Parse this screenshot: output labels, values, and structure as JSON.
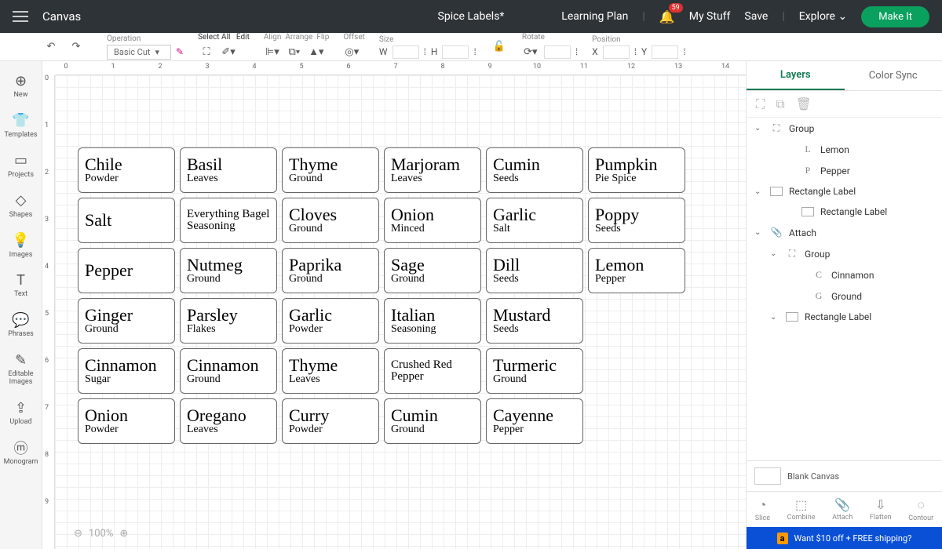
{
  "top": {
    "canvas": "Canvas",
    "title": "Spice Labels*",
    "learning": "Learning Plan",
    "badge": "59",
    "mystuff": "My Stuff",
    "save": "Save",
    "explore": "Explore",
    "makeit": "Make It"
  },
  "tool": {
    "operation": "Operation",
    "basiccut": "Basic Cut",
    "selectall": "Select All",
    "edit": "Edit",
    "align": "Align",
    "arrange": "Arrange",
    "flip": "Flip",
    "offset": "Offset",
    "size": "Size",
    "w": "W",
    "h": "H",
    "rotate": "Rotate",
    "position": "Position",
    "x": "X",
    "y": "Y"
  },
  "nav": [
    {
      "icon": "⊕",
      "label": "New"
    },
    {
      "icon": "👕",
      "label": "Templates"
    },
    {
      "icon": "▭",
      "label": "Projects"
    },
    {
      "icon": "◇",
      "label": "Shapes"
    },
    {
      "icon": "💡",
      "label": "Images"
    },
    {
      "icon": "T",
      "label": "Text"
    },
    {
      "icon": "💬",
      "label": "Phrases"
    },
    {
      "icon": "✎",
      "label": "Editable Images"
    },
    {
      "icon": "⇪",
      "label": "Upload"
    },
    {
      "icon": "ⓜ",
      "label": "Monogram"
    }
  ],
  "ruler_h": [
    "0",
    "1",
    "2",
    "3",
    "4",
    "5",
    "6",
    "7",
    "8",
    "9",
    "10",
    "11",
    "12",
    "13",
    "14"
  ],
  "ruler_v": [
    "0",
    "1",
    "2",
    "3",
    "4",
    "5",
    "6",
    "7",
    "8",
    "9"
  ],
  "spices": [
    {
      "t1": "Chile",
      "t2": "Powder"
    },
    {
      "t1": "Basil",
      "t2": "Leaves"
    },
    {
      "t1": "Thyme",
      "t2": "Ground"
    },
    {
      "t1": "Marjoram",
      "t2": "Leaves"
    },
    {
      "t1": "Cumin",
      "t2": "Seeds"
    },
    {
      "t1": "Pumpkin",
      "t2": "Pie Spice"
    },
    {
      "t1": "Salt",
      "t2": ""
    },
    {
      "t1": "Everything Bagel Seasoning",
      "t2": "",
      "small": true
    },
    {
      "t1": "Cloves",
      "t2": "Ground"
    },
    {
      "t1": "Onion",
      "t2": "Minced"
    },
    {
      "t1": "Garlic",
      "t2": "Salt"
    },
    {
      "t1": "Poppy",
      "t2": "Seeds"
    },
    {
      "t1": "Pepper",
      "t2": ""
    },
    {
      "t1": "Nutmeg",
      "t2": "Ground"
    },
    {
      "t1": "Paprika",
      "t2": "Ground"
    },
    {
      "t1": "Sage",
      "t2": "Ground"
    },
    {
      "t1": "Dill",
      "t2": "Seeds"
    },
    {
      "t1": "Lemon",
      "t2": "Pepper"
    },
    {
      "t1": "Ginger",
      "t2": "Ground"
    },
    {
      "t1": "Parsley",
      "t2": "Flakes"
    },
    {
      "t1": "Garlic",
      "t2": "Powder"
    },
    {
      "t1": "Italian",
      "t2": "Seasoning"
    },
    {
      "t1": "Mustard",
      "t2": "Seeds"
    },
    null,
    {
      "t1": "Cinnamon",
      "t2": "Sugar"
    },
    {
      "t1": "Cinnamon",
      "t2": "Ground"
    },
    {
      "t1": "Thyme",
      "t2": "Leaves"
    },
    {
      "t1": "Crushed Red Pepper",
      "t2": "",
      "small": true
    },
    {
      "t1": "Turmeric",
      "t2": "Ground"
    },
    null,
    {
      "t1": "Onion",
      "t2": "Powder"
    },
    {
      "t1": "Oregano",
      "t2": "Leaves"
    },
    {
      "t1": "Curry",
      "t2": "Powder"
    },
    {
      "t1": "Cumin",
      "t2": "Ground"
    },
    {
      "t1": "Cayenne",
      "t2": "Pepper"
    },
    null
  ],
  "zoom": "100%",
  "panel": {
    "layers": "Layers",
    "colorsync": "Color Sync",
    "blank": "Blank Canvas"
  },
  "layers": [
    {
      "ind": 0,
      "chev": "⌄",
      "gly": "⛶",
      "text": "Group"
    },
    {
      "ind": 2,
      "gly": "L",
      "text": "Lemon"
    },
    {
      "ind": 2,
      "gly": "P",
      "text": "Pepper"
    },
    {
      "ind": 0,
      "chev": "⌄",
      "sw": true,
      "text": "Rectangle Label"
    },
    {
      "ind": 2,
      "sw": true,
      "text": "Rectangle Label"
    },
    {
      "ind": 0,
      "chev": "⌄",
      "gly": "📎",
      "text": "Attach"
    },
    {
      "ind": 1,
      "chev": "⌄",
      "gly": "⛶",
      "text": "Group"
    },
    {
      "ind": 3,
      "gly": "C",
      "text": "Cinnamon"
    },
    {
      "ind": 3,
      "gly": "G",
      "text": "Ground"
    },
    {
      "ind": 1,
      "chev": "⌄",
      "sw": true,
      "text": "Rectangle Label"
    }
  ],
  "actions": [
    {
      "i": "◔",
      "t": "Slice"
    },
    {
      "i": "⬚",
      "t": "Combine"
    },
    {
      "i": "📎",
      "t": "Attach"
    },
    {
      "i": "⇩",
      "t": "Flatten"
    },
    {
      "i": "◌",
      "t": "Contour"
    }
  ],
  "promo": {
    "amz": "a",
    "text": "Want $10 off + FREE shipping?"
  }
}
